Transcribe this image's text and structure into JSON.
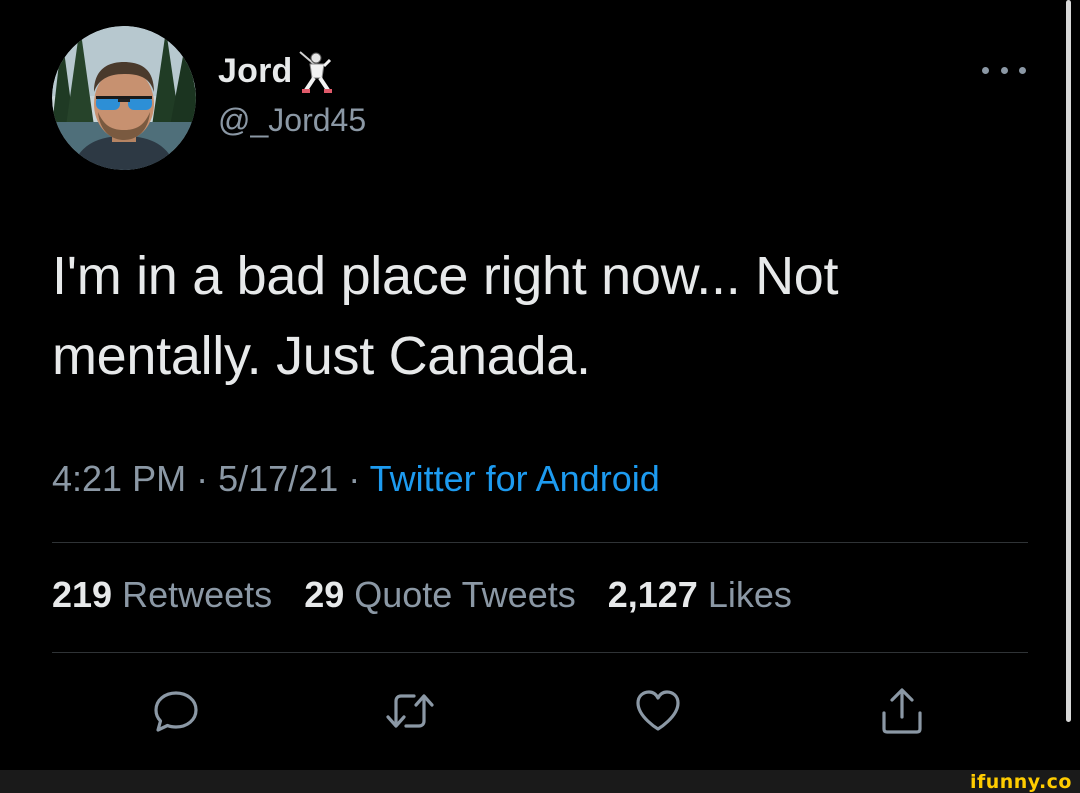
{
  "user": {
    "display_name": "Jord",
    "name_emoji_icon": "fencer-icon",
    "handle": "@_Jord45",
    "avatar_icon": "avatar-photo"
  },
  "tweet": {
    "text": "I'm in a bad place right now... Not mentally. Just Canada.",
    "time": "4:21 PM",
    "separator": "·",
    "date": "5/17/21",
    "source": "Twitter for Android"
  },
  "stats": {
    "retweets_count": "219",
    "retweets_label": "Retweets",
    "quotes_count": "29",
    "quotes_label": "Quote Tweets",
    "likes_count": "2,127",
    "likes_label": "Likes"
  },
  "actions": {
    "reply_icon": "reply-icon",
    "retweet_icon": "retweet-icon",
    "like_icon": "heart-icon",
    "share_icon": "share-icon"
  },
  "more_icon": "more-dots-icon",
  "watermark": {
    "text": "ifunny.co"
  },
  "colors": {
    "background": "#000000",
    "primary_text": "#e7e9ea",
    "secondary_text": "#8b98a5",
    "link": "#1d9bf0",
    "divider": "#2f3336",
    "watermark": "#ffcc00"
  }
}
